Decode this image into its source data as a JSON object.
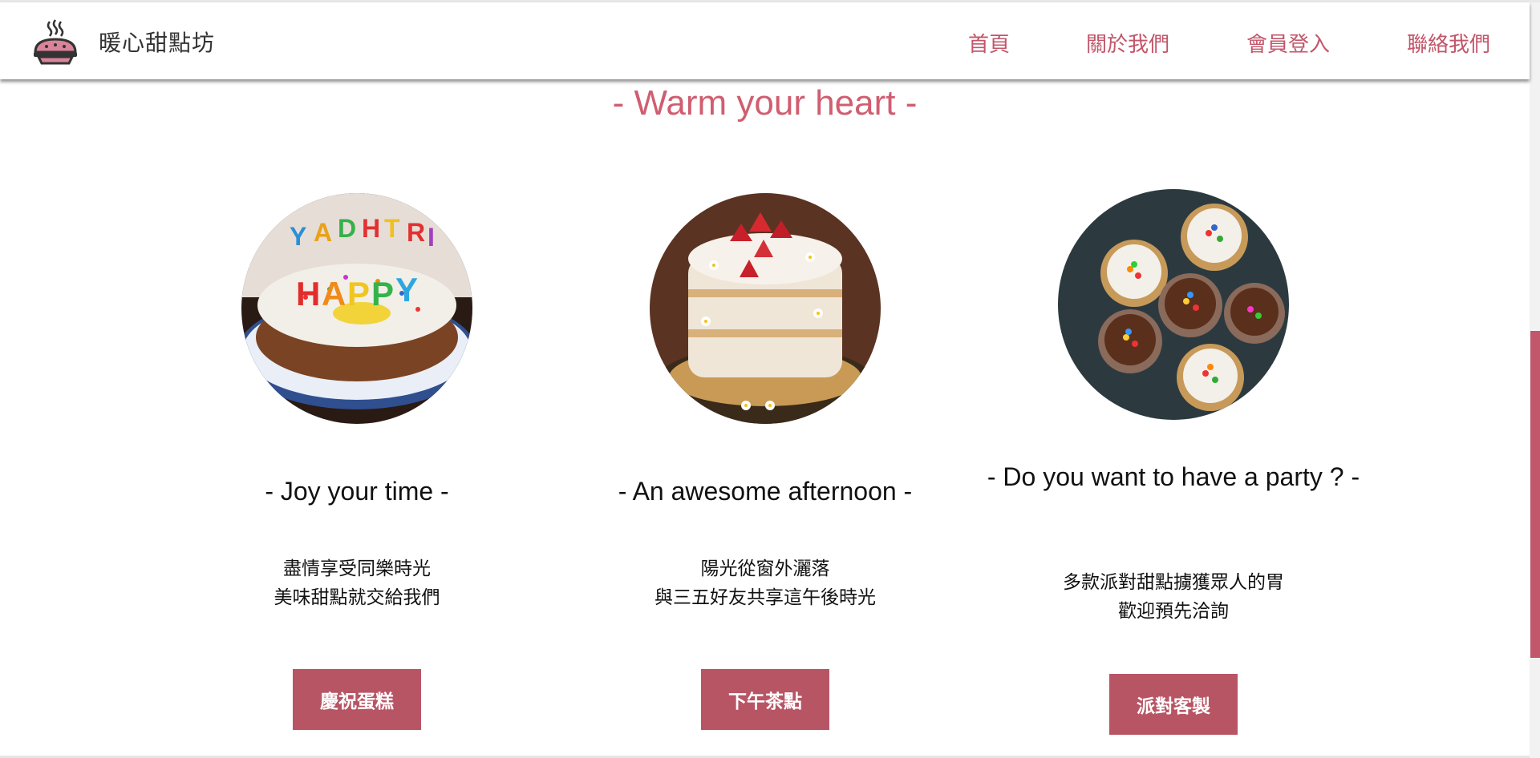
{
  "brand": {
    "name": "暖心甜點坊",
    "icon": "pie-steam-icon"
  },
  "nav": {
    "items": [
      "首頁",
      "關於我們",
      "會員登入",
      "聯絡我們"
    ]
  },
  "headline": "- Warm your heart -",
  "cards": [
    {
      "title": "- Joy your time -",
      "desc": [
        "盡情享受同樂時光",
        "美味甜點就交給我們"
      ],
      "button": "慶祝蛋糕",
      "image": "birthday-cake"
    },
    {
      "title": "- An awesome afternoon -",
      "desc": [
        "陽光從窗外灑落",
        "與三五好友共享這午後時光"
      ],
      "button": "下午茶點",
      "image": "strawberry-naked-cake"
    },
    {
      "title": "- Do you want to have a party ? -",
      "desc": [
        "多款派對甜點擄獲眾人的胃",
        "歡迎預先洽詢"
      ],
      "button": "派對客製",
      "image": "cupcakes"
    }
  ],
  "colors": {
    "accent": "#cf5e70",
    "button": "#b85565"
  }
}
